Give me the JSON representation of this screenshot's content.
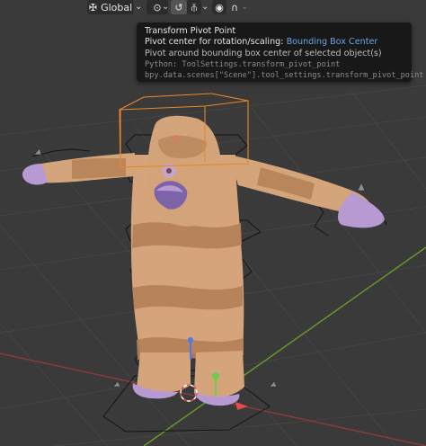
{
  "toolbar": {
    "orientation_label": "Global",
    "orientation_icon": "transform-orientation-icon",
    "pivot_icon": "pivot-point-icon",
    "snap_icon": "snap-icon",
    "proportional_icon": "proportional-editing-icon",
    "falloff_icon": "falloff-curve-icon"
  },
  "tooltip": {
    "title": "Transform Pivot Point",
    "desc_prefix": "Pivot center for rotation/scaling:",
    "desc_value": "Bounding Box Center",
    "detail": "Pivot around bounding box center of selected object(s)",
    "python_line1": "Python: ToolSettings.transform_pivot_point",
    "python_line2": "bpy.data.scenes[\"Scene\"].tool_settings.transform_pivot_point"
  },
  "colors": {
    "viewport_bg": "#3a3a3a",
    "grid": "#4a4a4a",
    "x_axis": "#9a3a3a",
    "y_axis": "#6e9a2a",
    "skin": "#d9a97a",
    "stripe": "#c08a62",
    "purple": "#b89ad2",
    "selection": "#e8872a",
    "tooltip_accent": "#6ba2e8"
  }
}
